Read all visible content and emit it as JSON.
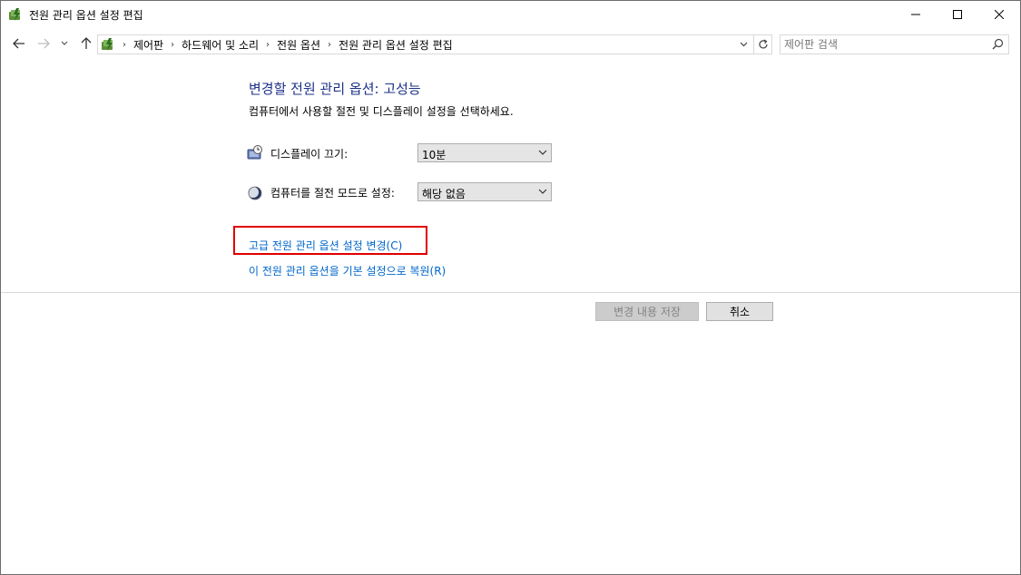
{
  "window": {
    "title": "전원 관리 옵션 설정 편집"
  },
  "address": {
    "breadcrumbs": [
      "제어판",
      "하드웨어 및 소리",
      "전원 옵션",
      "전원 관리 옵션 설정 편집"
    ]
  },
  "search": {
    "placeholder": "제어판 검색"
  },
  "main": {
    "heading": "변경할 전원 관리 옵션: 고성능",
    "subtitle": "컴퓨터에서 사용할 절전 및 디스플레이 설정을 선택하세요.",
    "settings": [
      {
        "label": "디스플레이 끄기:",
        "value": "10분",
        "icon": "monitor-clock-icon"
      },
      {
        "label": "컴퓨터를 절전 모드로 설정:",
        "value": "해당 없음",
        "icon": "moon-icon"
      }
    ],
    "links": {
      "advanced": "고급 전원 관리 옵션 설정 변경(C)",
      "restore": "이 전원 관리 옵션을 기본 설정으로 복원(R)"
    }
  },
  "buttons": {
    "save": "변경 내용 저장",
    "cancel": "취소"
  },
  "colors": {
    "heading": "#1e3287",
    "link": "#0066cc",
    "highlight": "#e00000"
  }
}
